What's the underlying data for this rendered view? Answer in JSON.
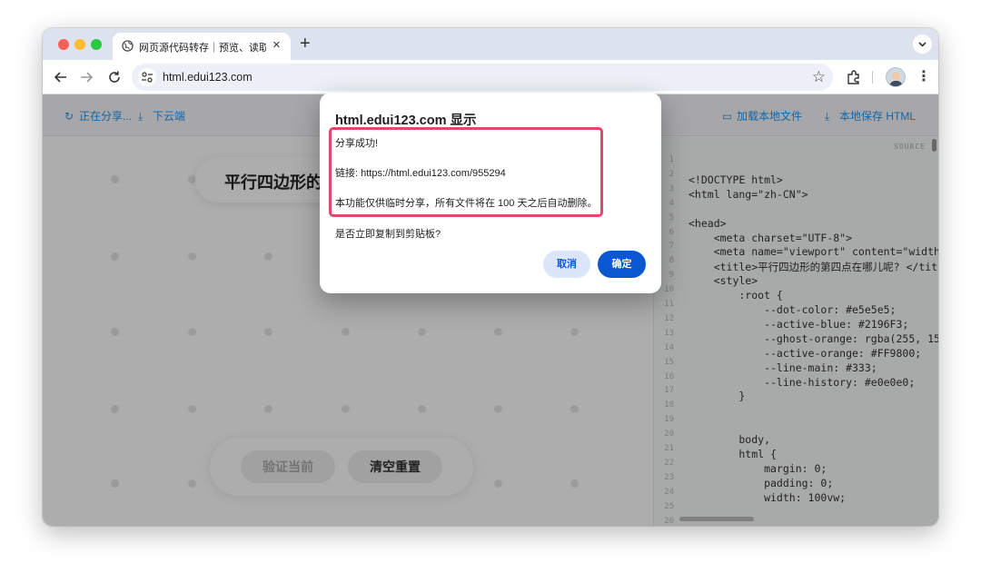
{
  "browser": {
    "tab_title": "网页源代码转存｜预览、读取、",
    "tab_close": "×",
    "new_tab": "+",
    "url": "html.edui123.com",
    "bookmark_star": "☆",
    "menu": "⋮"
  },
  "app": {
    "top_actions_left": [
      {
        "icon": "sync-icon",
        "glyph": "↻",
        "label": "正在分享..."
      },
      {
        "icon": "download-icon",
        "glyph": "⤓",
        "label": "下云端"
      }
    ],
    "top_actions_right": [
      {
        "icon": "folder-icon",
        "glyph": "▭",
        "label": "加载本地文件"
      },
      {
        "icon": "download-icon",
        "glyph": "⤓",
        "label": "本地保存 HTML"
      }
    ],
    "page_title": "平行四边形的",
    "verify_button": "验证当前",
    "clear_button": "清空重置",
    "source_tag": "SOURCE",
    "source_code": [
      "",
      "<!DOCTYPE html>",
      "<html lang=\"zh-CN\">",
      "",
      "<head>",
      "    <meta charset=\"UTF-8\">",
      "    <meta name=\"viewport\" content=\"width",
      "    <title>平行四边形的第四点在哪儿呢? </titl",
      "    <style>",
      "        :root {",
      "            --dot-color: #e5e5e5;",
      "            --active-blue: #2196F3;",
      "            --ghost-orange: rgba(255, 15",
      "            --active-orange: #FF9800;",
      "            --line-main: #333;",
      "            --line-history: #e0e0e0;",
      "        }",
      "",
      "",
      "        body,",
      "        html {",
      "            margin: 0;",
      "            padding: 0;",
      "            width: 100vw;",
      ""
    ],
    "line_numbers": [
      "1",
      "2",
      "3",
      "4",
      "5",
      "6",
      "7",
      "8",
      "9",
      "10",
      "11",
      "12",
      "13",
      "14",
      "15",
      "16",
      "17",
      "18",
      "19",
      "20",
      "21",
      "22",
      "23",
      "24",
      "25",
      "26"
    ]
  },
  "dialog": {
    "title": "html.edui123.com 显示",
    "success": "分享成功!",
    "link": "链接: https://html.edui123.com/955294",
    "note": "本功能仅供临时分享，所有文件将在 100 天之后自动删除。",
    "question": "是否立即复制到剪贴板?",
    "cancel": "取消",
    "confirm": "确定"
  },
  "colors": {
    "accent_blue": "#2196F3",
    "dialog_button": "#0b57d0",
    "highlight_border": "#e8456e"
  }
}
